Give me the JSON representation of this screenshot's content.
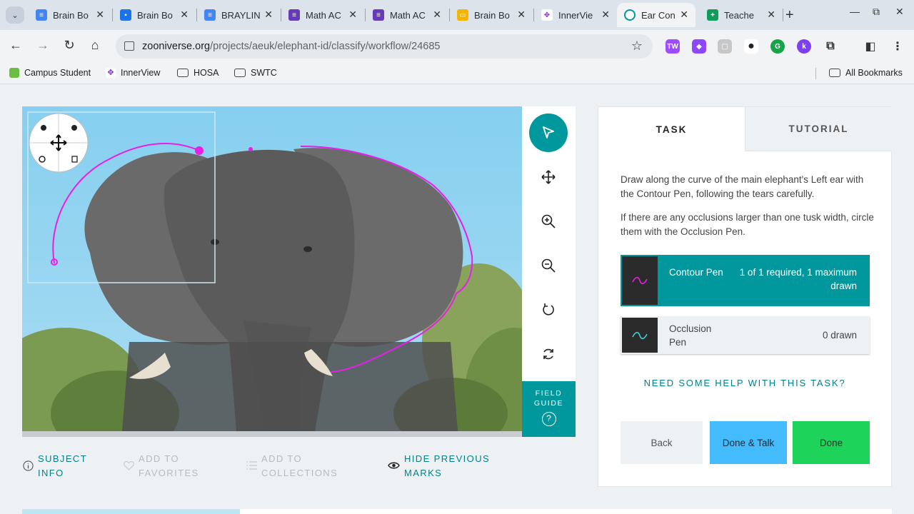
{
  "browser": {
    "tabs": [
      {
        "title": "Brain Bo",
        "icon": "docs-icon",
        "color": "#4285f4"
      },
      {
        "title": "Brain Bo",
        "icon": "classroom-icon",
        "color": "#1a73e8"
      },
      {
        "title": "BRAYLIN",
        "icon": "docs-icon",
        "color": "#4285f4"
      },
      {
        "title": "Math AC",
        "icon": "forms-icon",
        "color": "#673ab7"
      },
      {
        "title": "Math AC",
        "icon": "forms-icon",
        "color": "#673ab7"
      },
      {
        "title": "Brain Bo",
        "icon": "slides-icon",
        "color": "#f4b400"
      },
      {
        "title": "InnerVie",
        "icon": "innerview-icon",
        "color": "#7b2fbe"
      },
      {
        "title": "Ear Con",
        "icon": "zooniverse-icon",
        "color": "#00979d"
      },
      {
        "title": "Teache",
        "icon": "sheets-icon",
        "color": "#0f9d58"
      }
    ],
    "url_host": "zooniverse.org",
    "url_path": "/projects/aeuk/elephant-id/classify/workflow/24685",
    "bookmarks": [
      "Campus Student",
      "InnerView",
      "HOSA",
      "SWTC"
    ],
    "all_bookmarks": "All Bookmarks"
  },
  "classifier": {
    "tools": [
      "pointer-tool",
      "move-tool",
      "zoom-in-tool",
      "zoom-out-tool",
      "rotate-tool",
      "reset-tool"
    ],
    "field_guide": "FIELD GUIDE",
    "field_guide_q": "?"
  },
  "meta": {
    "subject_info": "SUBJECT INFO",
    "add_favorites": "ADD TO FAVORITES",
    "add_collections": "ADD TO COLLECTIONS",
    "hide_marks": "HIDE PREVIOUS MARKS"
  },
  "task": {
    "tab_task": "TASK",
    "tab_tutorial": "TUTORIAL",
    "instruction_1": "Draw along the curve of the main elephant's Left ear with the Contour Pen, following the tears carefully.",
    "instruction_2": "If there are any occlusions larger than one tusk width, circle them with the Occlusion Pen.",
    "tools": [
      {
        "label": "Contour Pen",
        "count": "1 of 1 required, 1 maximum drawn",
        "color": "#e91ee9"
      },
      {
        "label": "Occlusion Pen",
        "count": "0 drawn",
        "color": "#3fd0d8"
      }
    ],
    "help": "NEED SOME HELP WITH THIS TASK?",
    "back": "Back",
    "done_talk": "Done & Talk",
    "done": "Done"
  },
  "colors": {
    "accent": "#00979d",
    "contour": "#e91ee9",
    "done": "#1ed35a",
    "done_talk": "#43bbfd"
  }
}
